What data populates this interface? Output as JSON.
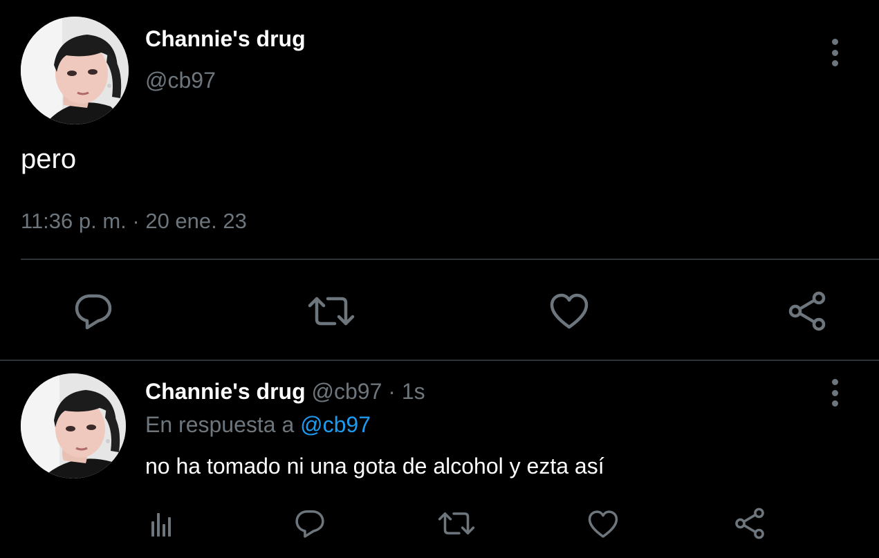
{
  "colors": {
    "background": "#000000",
    "text_primary": "#ffffff",
    "text_secondary": "#6e767d",
    "link": "#1d9bf0",
    "divider": "#2f3336"
  },
  "main_tweet": {
    "display_name": "Channie's drug",
    "handle": "@cb97",
    "text": "pero",
    "timestamp": "11:36 p. m. · 20 ene. 23",
    "more_icon": "more-vertical-icon",
    "actions": [
      {
        "name": "reply",
        "icon": "comment-icon"
      },
      {
        "name": "retweet",
        "icon": "retweet-icon"
      },
      {
        "name": "like",
        "icon": "heart-icon"
      },
      {
        "name": "share",
        "icon": "share-icon"
      }
    ]
  },
  "reply_tweet": {
    "display_name": "Channie's drug",
    "handle": "@cb97",
    "separator": " · ",
    "time": "1s",
    "context_prefix": "En respuesta a ",
    "context_mention": "@cb97",
    "text": "no ha tomado ni una gota de alcohol y ezta así",
    "more_icon": "more-vertical-icon",
    "actions": [
      {
        "name": "analytics",
        "icon": "analytics-icon"
      },
      {
        "name": "reply",
        "icon": "comment-icon"
      },
      {
        "name": "retweet",
        "icon": "retweet-icon"
      },
      {
        "name": "like",
        "icon": "heart-icon"
      },
      {
        "name": "share",
        "icon": "share-icon"
      }
    ]
  }
}
